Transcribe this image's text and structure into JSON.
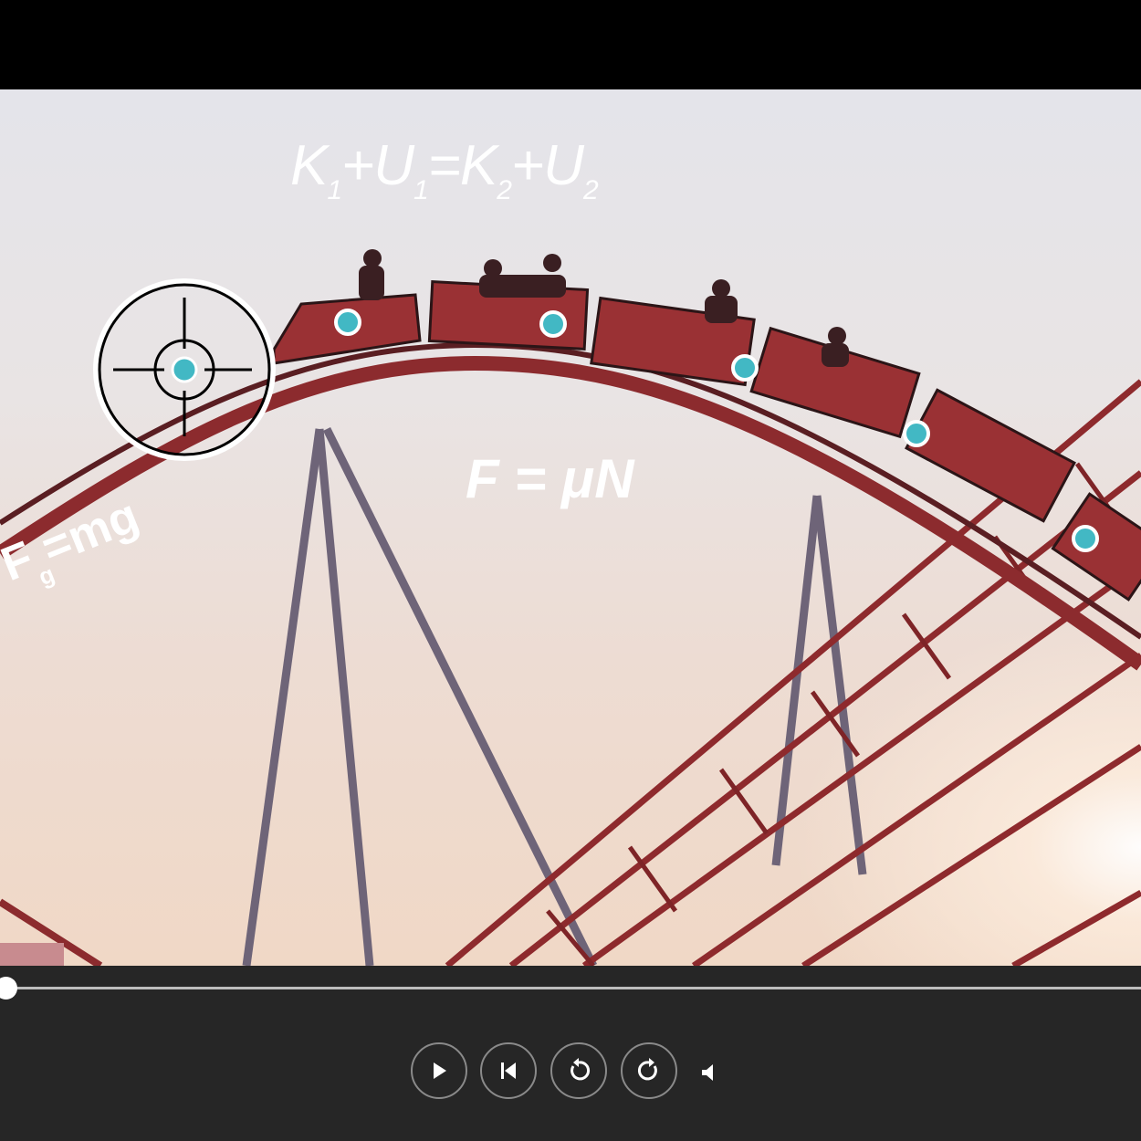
{
  "equations": {
    "energy": {
      "k1": "K",
      "s1": "1",
      "u1": "+U",
      "s2": "1",
      "eq": "=K",
      "s3": "2",
      "u2": "+U",
      "s4": "2"
    },
    "friction": "F = μN",
    "gravity": {
      "f": "F",
      "sub": "g",
      "rest": "=mg"
    }
  },
  "player": {
    "progress": 0,
    "buttons": [
      "play-icon",
      "restart-icon",
      "rewind-icon",
      "forward-icon"
    ],
    "accent": "#42b8c4"
  },
  "colors": {
    "track": "#9a2b2d",
    "support": "#6b5d78",
    "marker": "#42b8c4"
  }
}
